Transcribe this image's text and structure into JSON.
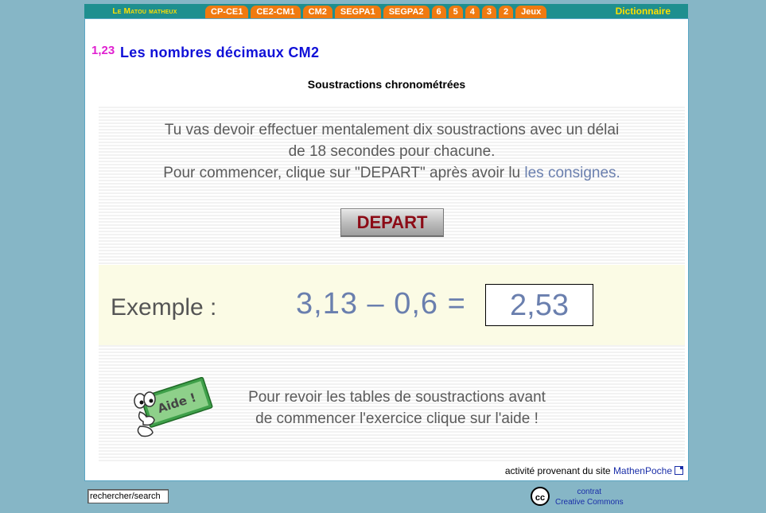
{
  "nav": {
    "brand": "Le Matou matheux",
    "tabs": [
      "CP-CE1",
      "CE2-CM1",
      "CM2",
      "SEGPA1",
      "SEGPA2",
      "6",
      "5",
      "4",
      "3",
      "2",
      "Jeux"
    ],
    "dictionary": "Dictionnaire"
  },
  "header": {
    "badge": "1,23",
    "title": "Les nombres décimaux CM2",
    "subtitle": "Soustractions chronométrées"
  },
  "instructions": {
    "line1": "Tu vas devoir effectuer mentalement dix soustractions avec un délai",
    "line2": "de 18 secondes pour chacune.",
    "line3_prefix": "Pour commencer, clique sur \"DEPART\" après avoir lu ",
    "line3_link": "les consignes."
  },
  "depart_label": "DEPART",
  "example": {
    "label": "Exemple :",
    "expression": "3,13 – 0,6 =",
    "answer": "2,53"
  },
  "help": {
    "sign_label": "Aide !",
    "line1": "Pour revoir les tables de soustractions avant",
    "line2": "de commencer l'exercice clique sur l'aide !"
  },
  "credit": {
    "prefix": "activité provenant du site ",
    "site": "MathenPoche"
  },
  "footer": {
    "search_value": "rechercher/search",
    "cc_icon_text": "cc",
    "cc_line1": "contrat",
    "cc_line2": "Creative Commons"
  },
  "colors": {
    "background": "#86b6c6",
    "nav_bar": "#1e8f8f",
    "tab": "#f07a10",
    "title": "#1010d8",
    "example_text": "#6a7fae",
    "depart_text": "#8c0b16"
  }
}
